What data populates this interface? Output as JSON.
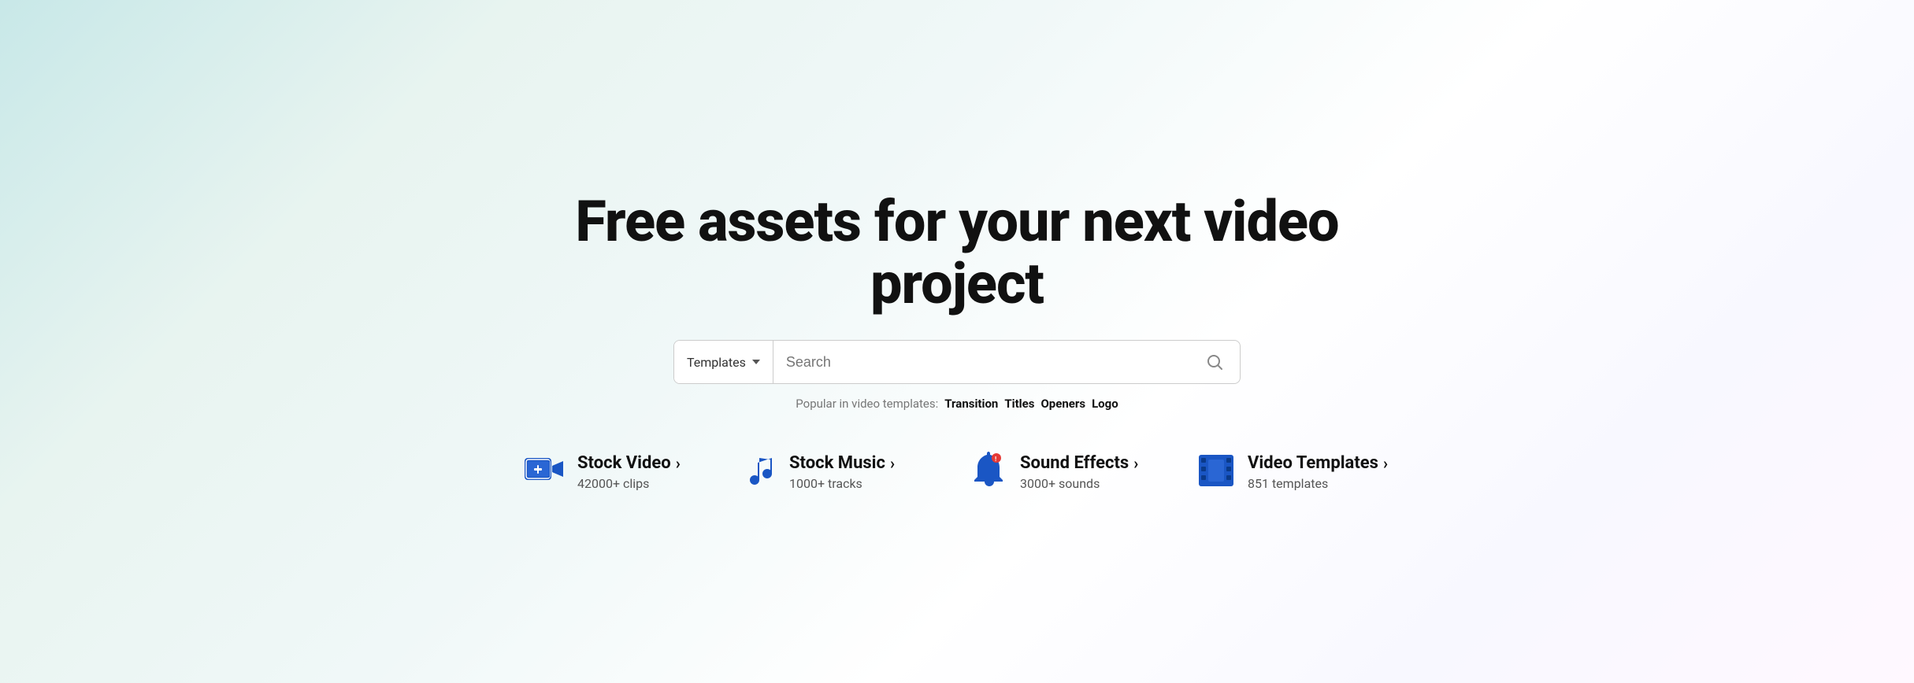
{
  "hero": {
    "title": "Free assets for your next video project"
  },
  "search": {
    "dropdown_label": "Templates",
    "placeholder": "Search",
    "search_icon_label": "search-icon"
  },
  "popular": {
    "label": "Popular in video templates:",
    "tags": [
      {
        "label": "Transition"
      },
      {
        "label": "Titles"
      },
      {
        "label": "Openers"
      },
      {
        "label": "Logo"
      }
    ]
  },
  "categories": [
    {
      "id": "stock-video",
      "name": "Stock Video",
      "count": "42000+ clips",
      "icon": "video-camera-icon"
    },
    {
      "id": "stock-music",
      "name": "Stock Music",
      "count": "1000+ tracks",
      "icon": "music-note-icon"
    },
    {
      "id": "sound-effects",
      "name": "Sound Effects",
      "count": "3000+ sounds",
      "icon": "bell-icon"
    },
    {
      "id": "video-templates",
      "name": "Video Templates",
      "count": "851 templates",
      "icon": "film-strip-icon"
    }
  ],
  "arrow_label": "›"
}
